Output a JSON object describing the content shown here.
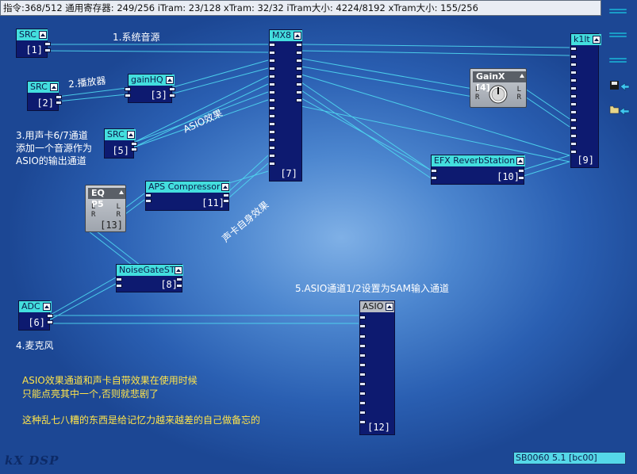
{
  "header": {
    "status_line": "指令:368/512 通用寄存器: 249/256 iTram: 23/128 xTram: 32/32 iTram大小: 4224/8192 xTram大小: 155/256"
  },
  "plugins": {
    "src1": {
      "title": "SRC",
      "index": "[1]"
    },
    "src2": {
      "title": "SRC",
      "index": "[2]"
    },
    "src5": {
      "title": "SRC",
      "index": "[5]"
    },
    "gainhq": {
      "title": "gainHQ",
      "index": "[3]"
    },
    "mx8": {
      "title": "MX8",
      "index": "[7]"
    },
    "k1lt": {
      "title": "k1lt",
      "index": "[9]"
    },
    "gainx": {
      "title": "GainX [4]",
      "pin_l": "L",
      "pin_r": "R",
      "pin_l_out": "L",
      "pin_r_out": "R"
    },
    "efx": {
      "title": "EFX ReverbStation",
      "index": "[10]"
    },
    "eqp5": {
      "title": "EQ P5",
      "index": "[13]",
      "pin_l": "L",
      "pin_r": "R",
      "pin_l_out": "L",
      "pin_r_out": "R"
    },
    "aps": {
      "title": "APS Compressor",
      "index": "[11]"
    },
    "noisegate": {
      "title": "NoiseGateST",
      "index": "[8]"
    },
    "adc": {
      "title": "ADC",
      "index": "[6]"
    },
    "asio": {
      "title": "ASIO",
      "index": "[12]"
    }
  },
  "annotations": {
    "a1": "1.系统音源",
    "a2": "2.播放器",
    "a3_line1": "3.用声卡6/7通道",
    "a3_line2": "添加一个音源作为",
    "a3_line3": "ASIO的输出通道",
    "asio_effect": "ASIO效果",
    "card_effect": "声卡自身效果",
    "a4": "4.麦克风",
    "a5": "5.ASIO通道1/2设置为SAM输入通道",
    "note1": "ASIO效果通道和声卡自带效果在使用时候",
    "note2": "只能点亮其中一个,否则就悲剧了",
    "note3": "这种乱七八糟的东西是给记忆力越来越差的自己做备忘的"
  },
  "footer": {
    "logo": "kX DSP",
    "device": "SB0060 5.1 [bc00]"
  },
  "toolbar_icons": [
    "menu-icon",
    "menu-icon",
    "menu-icon",
    "save-icon",
    "open-icon"
  ],
  "colors": {
    "plugin_title": "#43dede",
    "plugin_body": "#0d1a70",
    "wire": "#4fd8f0",
    "note_text": "#ffe44a"
  }
}
